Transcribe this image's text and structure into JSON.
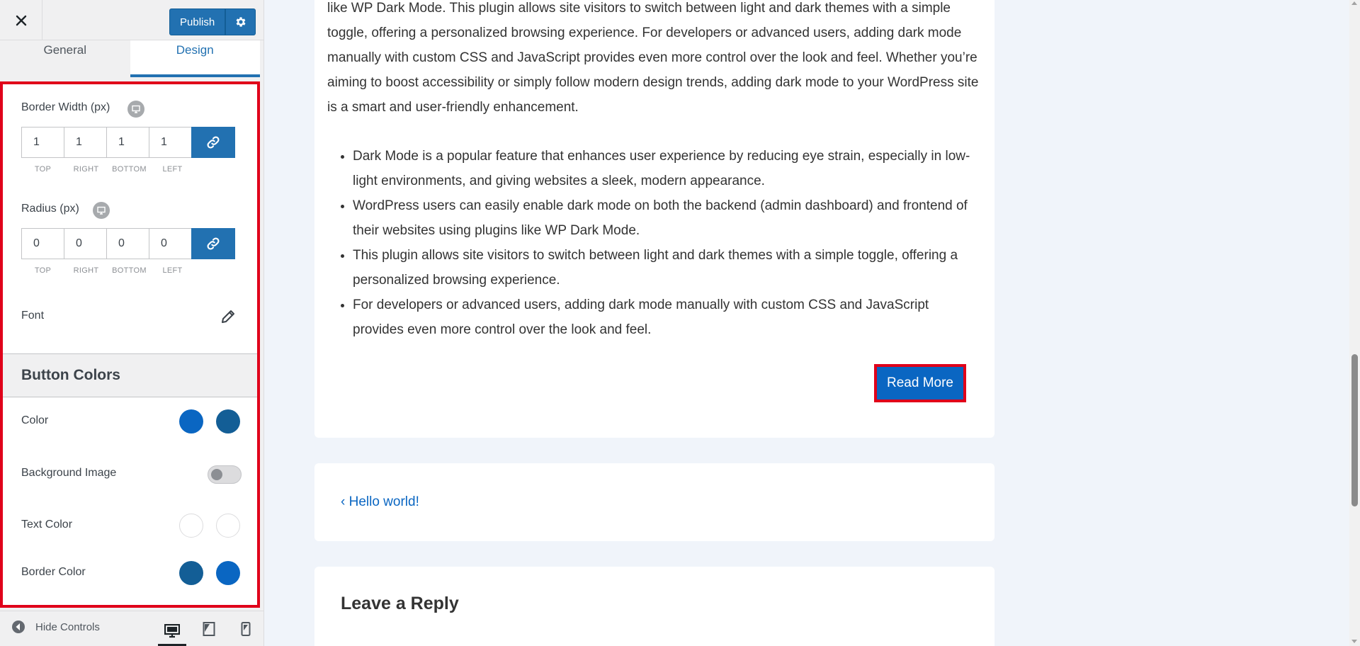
{
  "panel": {
    "close_icon": "close-icon",
    "publish_label": "Publish",
    "settings_icon": "gear-icon",
    "tabs": [
      {
        "label": "General",
        "active": false
      },
      {
        "label": "Design",
        "active": true
      }
    ]
  },
  "design": {
    "border_width": {
      "label": "Border Width (px)",
      "values": [
        "1",
        "1",
        "1",
        "1"
      ]
    },
    "radius": {
      "label": "Radius (px)",
      "values": [
        "0",
        "0",
        "0",
        "0"
      ]
    },
    "dim_labels": [
      "TOP",
      "RIGHT",
      "BOTTOM",
      "LEFT"
    ],
    "font_label": "Font",
    "button_colors": {
      "heading": "Button Colors",
      "color_label": "Color",
      "color_values": [
        "#0a66c2",
        "#135e96"
      ],
      "background_image_label": "Background Image",
      "background_image_enabled": false,
      "text_color_label": "Text Color",
      "text_color_values": [
        "#ffffff",
        "#ffffff"
      ],
      "border_color_label": "Border Color",
      "border_color_values": [
        "#135e96",
        "#0a66c2"
      ]
    }
  },
  "footer": {
    "hide_controls_label": "Hide Controls",
    "devices": [
      "desktop-icon",
      "tablet-icon",
      "mobile-icon"
    ]
  },
  "preview": {
    "paragraph": "like WP Dark Mode. This plugin allows site visitors to switch between light and dark themes with a simple toggle, offering a personalized browsing experience. For developers or advanced users, adding dark mode manually with custom CSS and JavaScript provides even more control over the look and feel. Whether you’re aiming to boost accessibility or simply follow modern design trends, adding dark mode to your WordPress site is a smart and user-friendly enhancement.",
    "bullets": [
      "Dark Mode is a popular feature that enhances user experience by reducing eye strain, especially in low-light environments, and giving websites a sleek, modern appearance.",
      "WordPress users can easily enable dark mode on both the backend (admin dashboard) and frontend of their websites using plugins like WP Dark Mode.",
      "This plugin allows site visitors to switch between light and dark themes with a simple toggle, offering a personalized browsing experience.",
      "For developers or advanced users, adding dark mode manually with custom CSS and JavaScript provides even more control over the look and feel."
    ],
    "read_more_label": "Read More",
    "prev_post_label": "‹ Hello world!",
    "reply_title": "Leave a Reply"
  },
  "colors": {
    "accent": "#2271b1",
    "highlight": "#e0001a",
    "button": "#0a66c2"
  }
}
